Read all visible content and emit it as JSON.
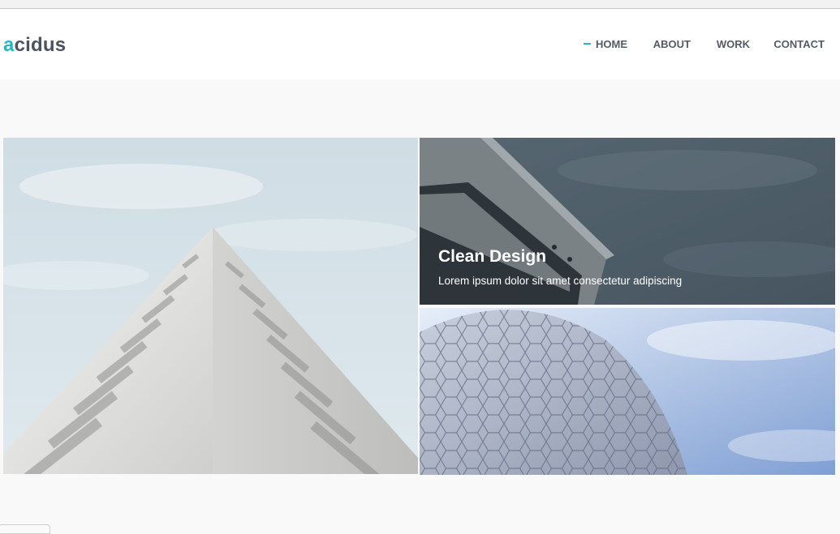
{
  "brand": {
    "logo_accent": "a",
    "logo_rest": "cidus",
    "accent_color": "#22b8c6"
  },
  "nav": {
    "items": [
      {
        "label": "HOME",
        "active": true
      },
      {
        "label": "ABOUT"
      },
      {
        "label": "WORK"
      },
      {
        "label": "CONTACT"
      }
    ]
  },
  "gallery": {
    "featured": {
      "title": "Clean Design",
      "text": "Lorem ipsum dolor sit amet consectetur adipiscing"
    }
  }
}
